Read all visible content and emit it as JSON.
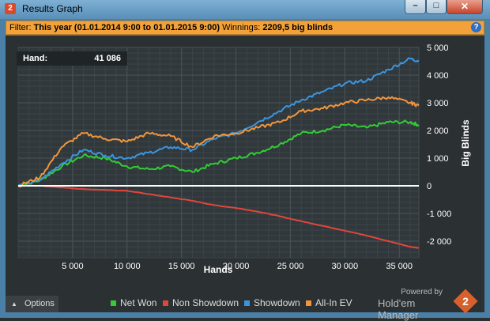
{
  "window": {
    "title": "Results Graph",
    "app_icon": "2"
  },
  "filter": {
    "label": "Filter:",
    "value": "This year (01.01.2014 9:00 to 01.01.2015 9:00)",
    "winnings_label": "Winnings:",
    "winnings_value": "2209,5 big blinds"
  },
  "hand_readout": {
    "label": "Hand:",
    "value": "41 086"
  },
  "options_label": "Options",
  "branding": {
    "powered": "Powered by",
    "name": "Hold'em Manager",
    "logo": "2"
  },
  "colors": {
    "net_won": "#33cc33",
    "non_showdown": "#e0463c",
    "showdown": "#3b95dd",
    "all_in_ev": "#f0963c",
    "zero_line": "#ffffff",
    "filter_bar": "#f3a23a"
  },
  "chart_data": {
    "type": "line",
    "xlabel": "Hands",
    "ylabel": "Big Blinds",
    "x_ticks": [
      "5 000",
      "10 000",
      "15 000",
      "20 000",
      "25 000",
      "30 000",
      "35 000"
    ],
    "y_ticks": [
      "5 000",
      "4 000",
      "3 000",
      "2 000",
      "1 000",
      "0",
      "-1 000",
      "-2 000"
    ],
    "xlim": [
      0,
      36800
    ],
    "ylim": [
      -2600,
      5000
    ],
    "grid": true,
    "legend_position": "bottom",
    "x": [
      0,
      2000,
      4000,
      6000,
      8000,
      10000,
      12000,
      14000,
      16000,
      18000,
      20000,
      22000,
      24000,
      26000,
      28000,
      30000,
      32000,
      34000,
      36000,
      36800
    ],
    "series": [
      {
        "name": "Net Won",
        "color": "#33cc33",
        "values": [
          0,
          200,
          700,
          1100,
          1000,
          700,
          600,
          700,
          500,
          800,
          1000,
          1200,
          1500,
          1900,
          2000,
          2200,
          2100,
          2300,
          2300,
          2200
        ]
      },
      {
        "name": "Non Showdown",
        "color": "#e0463c",
        "values": [
          0,
          0,
          -60,
          -120,
          -150,
          -180,
          -300,
          -420,
          -540,
          -700,
          -800,
          -930,
          -1100,
          -1280,
          -1450,
          -1620,
          -1800,
          -2000,
          -2200,
          -2250
        ]
      },
      {
        "name": "Showdown",
        "color": "#3b95dd",
        "values": [
          0,
          200,
          800,
          1300,
          1100,
          1000,
          1200,
          1400,
          1300,
          1700,
          1900,
          2300,
          2700,
          3100,
          3400,
          3700,
          3800,
          4200,
          4600,
          4500
        ]
      },
      {
        "name": "All-In EV",
        "color": "#f0963c",
        "values": [
          0,
          300,
          1400,
          1900,
          1700,
          1600,
          1900,
          1800,
          1400,
          1800,
          1900,
          2100,
          2300,
          2700,
          2800,
          3000,
          3100,
          3200,
          3000,
          2900
        ]
      }
    ]
  }
}
